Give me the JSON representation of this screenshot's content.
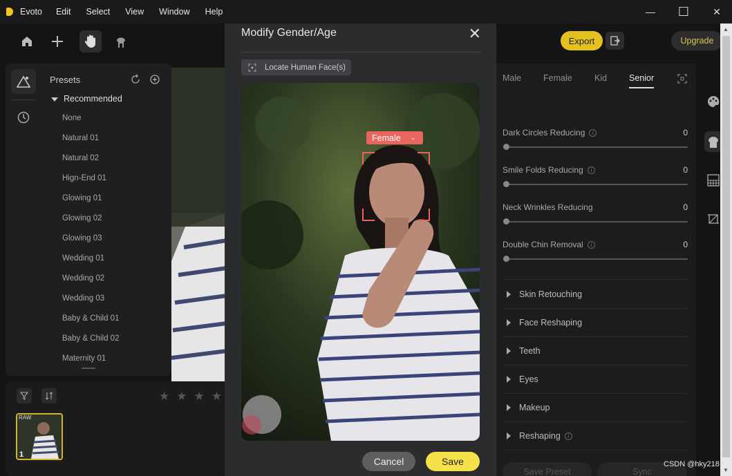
{
  "window": {
    "app_name": "Evoto",
    "menu": [
      "Edit",
      "Select",
      "View",
      "Window",
      "Help"
    ],
    "minimize": "—",
    "maximize": "☐",
    "close": "✕"
  },
  "toolbar": {
    "export_label": "Export",
    "upgrade_label": "Upgrade",
    "accent": "#e3c21f"
  },
  "presets": {
    "header": "Presets",
    "section": "Recommended",
    "items": [
      "None",
      "Natural 01",
      "Natural 02",
      "Hign-End 01",
      "Glowing 01",
      "Glowing 02",
      "Glowing 03",
      "Wedding 01",
      "Wedding 02",
      "Wedding 03",
      "Baby & Child 01",
      "Baby & Child 02",
      "Maternity 01"
    ]
  },
  "filmstrip": {
    "raw_badge": "RAW",
    "index": "1"
  },
  "right_panel": {
    "tabs": [
      "Male",
      "Female",
      "Kid",
      "Senior"
    ],
    "active_tab": "Senior",
    "sliders": [
      {
        "label": "Dark Circles Reducing",
        "value": "0"
      },
      {
        "label": "Smile Folds Reducing",
        "value": "0"
      },
      {
        "label": "Neck Wrinkles Reducing",
        "value": "0"
      },
      {
        "label": "Double Chin Removal",
        "value": "0"
      }
    ],
    "sections": [
      "Skin Retouching",
      "Face Reshaping",
      "Teeth",
      "Eyes",
      "Makeup",
      "Reshaping"
    ],
    "save_preset": "Save Preset",
    "sync": "Sync"
  },
  "modal": {
    "title": "Modify Gender/Age",
    "locate_button": "Locate Human Face(s)",
    "gender_tag": "Female",
    "cancel": "Cancel",
    "save": "Save",
    "face_color": "#e8665e",
    "save_color": "#f5e14a"
  },
  "watermark": "CSDN @hky218"
}
